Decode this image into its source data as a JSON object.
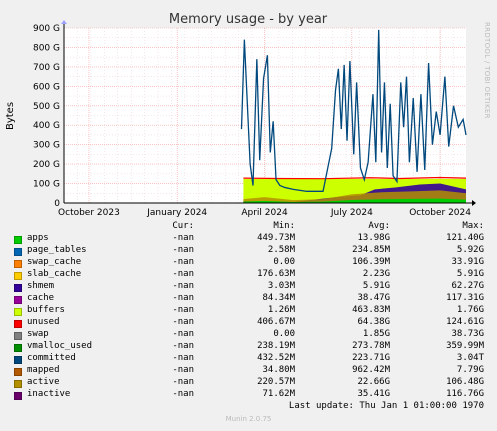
{
  "chart_data": {
    "type": "area",
    "title": "Memory usage - by year",
    "ylabel": "Bytes",
    "side_label": "RRDTOOL / TOBI OETIKER",
    "ylim": [
      0,
      900
    ],
    "y_unit": "G",
    "yticks": [
      "0",
      "100 G",
      "200 G",
      "300 G",
      "400 G",
      "500 G",
      "600 G",
      "700 G",
      "800 G",
      "900 G"
    ],
    "xlim": [
      "2023-09-05",
      "2024-10-28"
    ],
    "xticks": [
      {
        "date": "2023-10-01",
        "label": "October 2023"
      },
      {
        "date": "2024-01-01",
        "label": "January 2024"
      },
      {
        "date": "2024-04-01",
        "label": "April 2024"
      },
      {
        "date": "2024-07-01",
        "label": "July 2024"
      },
      {
        "date": "2024-10-01",
        "label": "October 2024"
      }
    ],
    "grid": true,
    "data_start": "2024-03-08",
    "unused_band": {
      "from": "2024-03-10",
      "to": "2024-10-28",
      "value": 124
    },
    "committed_points": [
      [
        "2024-03-08",
        380
      ],
      [
        "2024-03-11",
        840
      ],
      [
        "2024-03-14",
        520
      ],
      [
        "2024-03-17",
        200
      ],
      [
        "2024-03-20",
        90
      ],
      [
        "2024-03-24",
        740
      ],
      [
        "2024-03-27",
        220
      ],
      [
        "2024-03-31",
        640
      ],
      [
        "2024-04-04",
        760
      ],
      [
        "2024-04-07",
        260
      ],
      [
        "2024-04-10",
        420
      ],
      [
        "2024-04-13",
        120
      ],
      [
        "2024-04-17",
        90
      ],
      [
        "2024-04-22",
        80
      ],
      [
        "2024-05-01",
        70
      ],
      [
        "2024-05-15",
        60
      ],
      [
        "2024-06-01",
        60
      ],
      [
        "2024-06-10",
        280
      ],
      [
        "2024-06-14",
        580
      ],
      [
        "2024-06-17",
        690
      ],
      [
        "2024-06-20",
        380
      ],
      [
        "2024-06-23",
        710
      ],
      [
        "2024-06-26",
        320
      ],
      [
        "2024-06-29",
        730
      ],
      [
        "2024-07-03",
        250
      ],
      [
        "2024-07-06",
        620
      ],
      [
        "2024-07-10",
        180
      ],
      [
        "2024-07-14",
        120
      ],
      [
        "2024-07-18",
        210
      ],
      [
        "2024-07-23",
        560
      ],
      [
        "2024-07-26",
        210
      ],
      [
        "2024-07-29",
        890
      ],
      [
        "2024-08-01",
        260
      ],
      [
        "2024-08-04",
        620
      ],
      [
        "2024-08-07",
        180
      ],
      [
        "2024-08-10",
        510
      ],
      [
        "2024-08-13",
        140
      ],
      [
        "2024-08-17",
        110
      ],
      [
        "2024-08-21",
        620
      ],
      [
        "2024-08-24",
        390
      ],
      [
        "2024-08-27",
        650
      ],
      [
        "2024-08-30",
        210
      ],
      [
        "2024-09-03",
        540
      ],
      [
        "2024-09-07",
        160
      ],
      [
        "2024-09-11",
        560
      ],
      [
        "2024-09-15",
        170
      ],
      [
        "2024-09-19",
        720
      ],
      [
        "2024-09-23",
        300
      ],
      [
        "2024-09-27",
        470
      ],
      [
        "2024-10-01",
        350
      ],
      [
        "2024-10-06",
        650
      ],
      [
        "2024-10-10",
        290
      ],
      [
        "2024-10-15",
        500
      ],
      [
        "2024-10-20",
        390
      ],
      [
        "2024-10-25",
        430
      ],
      [
        "2024-10-28",
        350
      ]
    ],
    "active_points": [
      [
        "2024-03-10",
        20
      ],
      [
        "2024-04-01",
        30
      ],
      [
        "2024-05-01",
        15
      ],
      [
        "2024-06-01",
        20
      ],
      [
        "2024-07-01",
        45
      ],
      [
        "2024-08-01",
        55
      ],
      [
        "2024-09-01",
        60
      ],
      [
        "2024-10-01",
        65
      ],
      [
        "2024-10-28",
        50
      ]
    ],
    "cache_points": [
      [
        "2024-03-10",
        10
      ],
      [
        "2024-05-01",
        5
      ],
      [
        "2024-06-15",
        30
      ],
      [
        "2024-07-10",
        40
      ],
      [
        "2024-07-25",
        70
      ],
      [
        "2024-08-15",
        80
      ],
      [
        "2024-09-10",
        95
      ],
      [
        "2024-10-01",
        100
      ],
      [
        "2024-10-28",
        70
      ]
    ],
    "swap_points": [
      [
        "2024-03-10",
        128
      ],
      [
        "2024-04-15",
        126
      ],
      [
        "2024-06-01",
        125
      ],
      [
        "2024-07-20",
        130
      ],
      [
        "2024-08-20",
        126
      ],
      [
        "2024-10-01",
        131
      ],
      [
        "2024-10-28",
        128
      ]
    ],
    "legend_header": {
      "cur": "Cur:",
      "min": "Min:",
      "avg": "Avg:",
      "max": "Max:"
    },
    "legend": [
      {
        "name": "apps",
        "color": "#00cc00",
        "cur": "-nan",
        "min": "449.73M",
        "avg": "13.98G",
        "max": "121.40G"
      },
      {
        "name": "page_tables",
        "color": "#0066b3",
        "cur": "-nan",
        "min": "2.58M",
        "avg": "234.85M",
        "max": "5.92G"
      },
      {
        "name": "swap_cache",
        "color": "#ff8000",
        "cur": "-nan",
        "min": "0.00",
        "avg": "106.39M",
        "max": "33.91G"
      },
      {
        "name": "slab_cache",
        "color": "#ffcc00",
        "cur": "-nan",
        "min": "176.63M",
        "avg": "2.23G",
        "max": "5.91G"
      },
      {
        "name": "shmem",
        "color": "#330099",
        "cur": "-nan",
        "min": "3.03M",
        "avg": "5.91G",
        "max": "62.27G"
      },
      {
        "name": "cache",
        "color": "#990099",
        "cur": "-nan",
        "min": "84.34M",
        "avg": "38.47G",
        "max": "117.31G"
      },
      {
        "name": "buffers",
        "color": "#ccff00",
        "cur": "-nan",
        "min": "1.26M",
        "avg": "463.83M",
        "max": "1.76G"
      },
      {
        "name": "unused",
        "color": "#ff0000",
        "cur": "-nan",
        "min": "406.67M",
        "avg": "64.38G",
        "max": "124.61G"
      },
      {
        "name": "swap",
        "color": "#808080",
        "cur": "-nan",
        "min": "0.00",
        "avg": "1.85G",
        "max": "38.73G"
      },
      {
        "name": "vmalloc_used",
        "color": "#008f00",
        "cur": "-nan",
        "min": "238.19M",
        "avg": "273.78M",
        "max": "359.99M"
      },
      {
        "name": "committed",
        "color": "#00487d",
        "cur": "-nan",
        "min": "432.52M",
        "avg": "223.71G",
        "max": "3.04T"
      },
      {
        "name": "mapped",
        "color": "#b35a00",
        "cur": "-nan",
        "min": "34.80M",
        "avg": "962.42M",
        "max": "7.79G"
      },
      {
        "name": "active",
        "color": "#b38f00",
        "cur": "-nan",
        "min": "220.57M",
        "avg": "22.66G",
        "max": "106.48G"
      },
      {
        "name": "inactive",
        "color": "#6b006b",
        "cur": "-nan",
        "min": "71.62M",
        "avg": "35.41G",
        "max": "116.76G"
      }
    ],
    "legend_colors_plot": {
      "unused_fill": "#ccff00",
      "swap_line": "#ff0000",
      "cache_fill": "#330099",
      "active_fill": "#b38f00",
      "apps_fill": "#00cc00",
      "committed_line": "#00487d"
    },
    "last_update": "Last update: Thu Jan  1 01:00:00 1970",
    "munin_version": "Munin 2.0.75"
  }
}
